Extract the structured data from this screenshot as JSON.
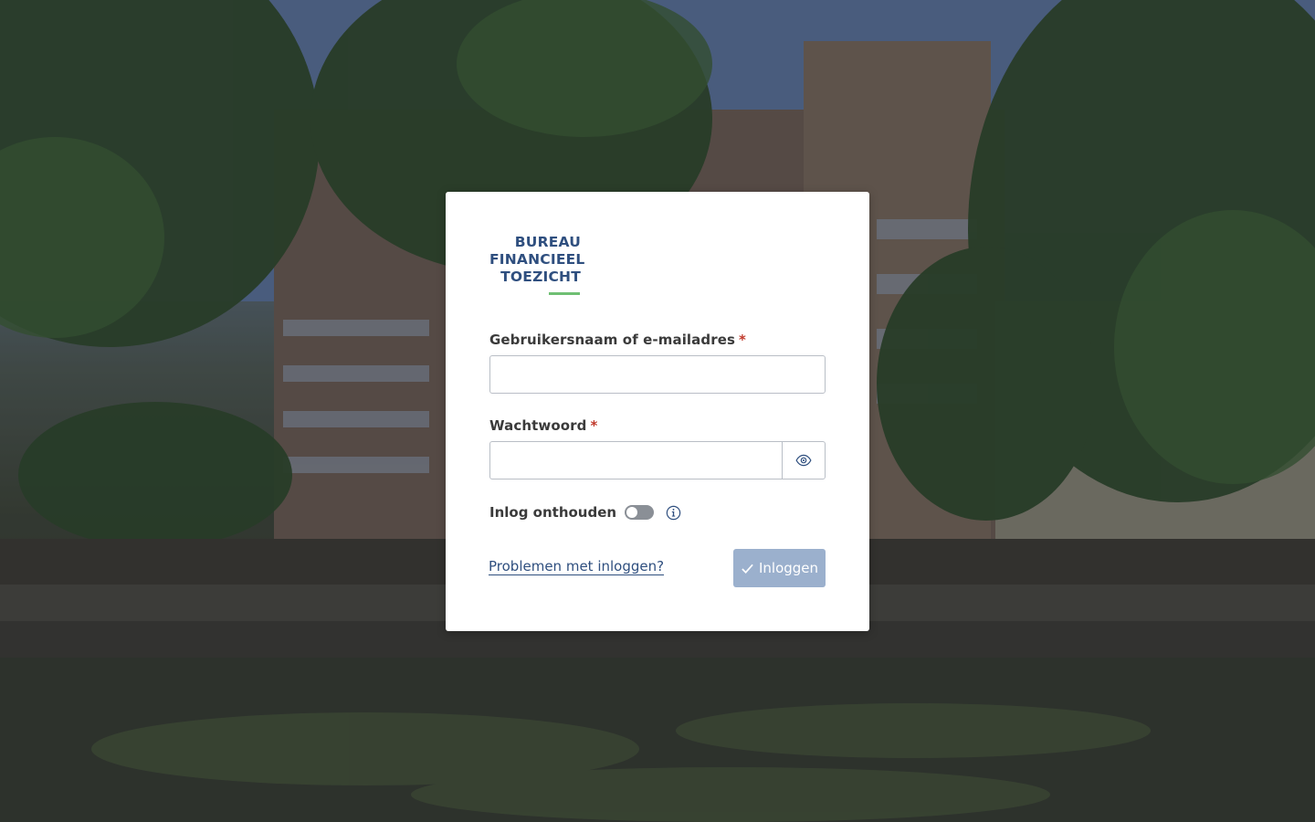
{
  "logo": {
    "lines": [
      "BUREAU",
      "FINANCIEEL",
      "TOEZICHT"
    ],
    "underline_color": "#6fbf73",
    "text_color": "#2f4f7f"
  },
  "form": {
    "username": {
      "label": "Gebruikersnaam of e-mailadres",
      "required_marker": "*",
      "value": "",
      "placeholder": ""
    },
    "password": {
      "label": "Wachtwoord",
      "required_marker": "*",
      "value": "",
      "placeholder": "",
      "toggle_icon": "eye-icon"
    },
    "remember": {
      "label": "Inlog onthouden",
      "enabled": false,
      "info_icon": "info-icon"
    },
    "trouble_link": "Problemen met inloggen?",
    "submit": {
      "label": "Inloggen",
      "icon": "check-icon",
      "color": "#9bb0cd"
    }
  }
}
